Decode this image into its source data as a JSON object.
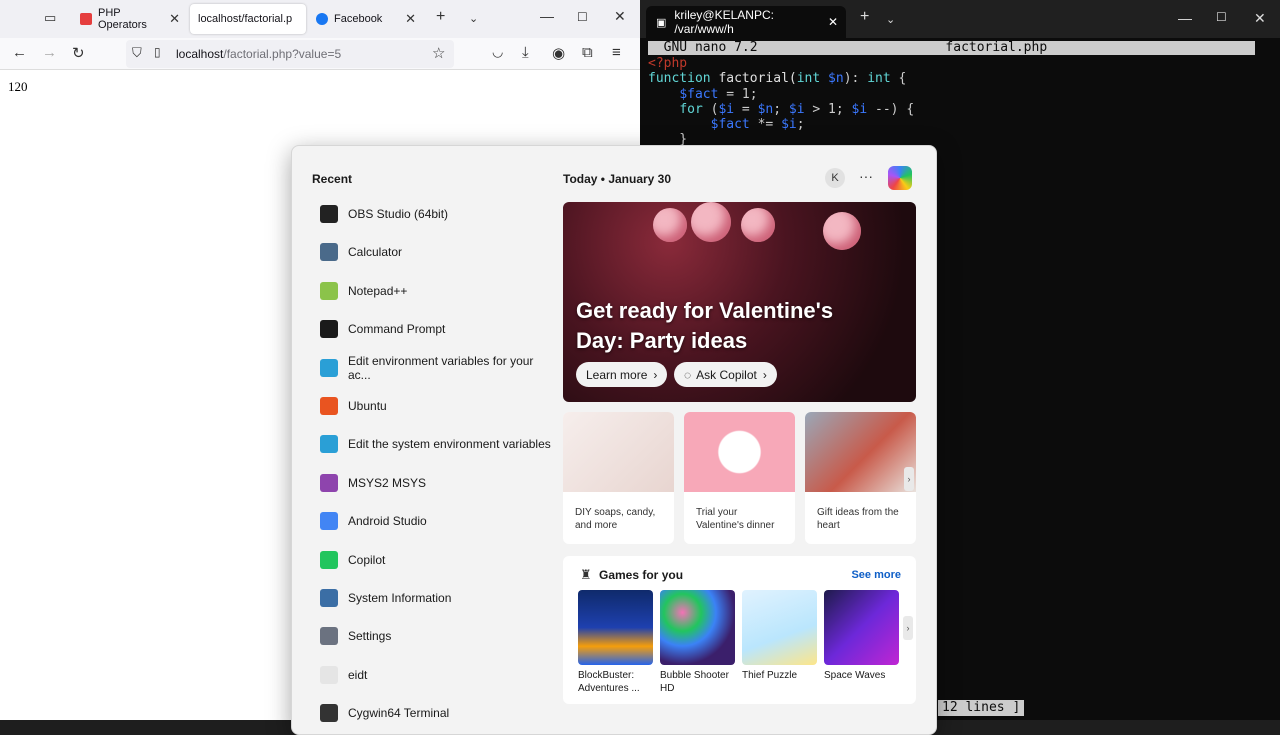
{
  "browser": {
    "tabs": [
      {
        "label": "PHP Operators",
        "favicon_color": "#e53e3e"
      },
      {
        "label": "localhost/factorial.p",
        "favicon_color": "#ffffff"
      },
      {
        "label": "Facebook",
        "favicon_color": "#1877f2"
      }
    ],
    "url_host": "localhost",
    "url_path": "/factorial.php?value=5",
    "page_output": "120"
  },
  "terminal": {
    "tab_title": "kriley@KELANPC: /var/www/h",
    "nano_header": "  GNU nano 7.2                        factorial.php",
    "status": "12 lines ]"
  },
  "start_menu": {
    "recent_title": "Recent",
    "recent_apps": [
      {
        "label": "OBS Studio (64bit)",
        "icon": "obs-icon",
        "color": "#222222"
      },
      {
        "label": "Calculator",
        "icon": "calculator-icon",
        "color": "#4a6a8a"
      },
      {
        "label": "Notepad++",
        "icon": "notepad-plus-plus-icon",
        "color": "#8bc34a"
      },
      {
        "label": "Command Prompt",
        "icon": "command-prompt-icon",
        "color": "#1a1a1a"
      },
      {
        "label": "Edit environment variables for your ac...",
        "icon": "monitor-icon",
        "color": "#2a9fd6"
      },
      {
        "label": "Ubuntu",
        "icon": "ubuntu-icon",
        "color": "#e95420"
      },
      {
        "label": "Edit the system environment variables",
        "icon": "monitor-icon",
        "color": "#2a9fd6"
      },
      {
        "label": "MSYS2 MSYS",
        "icon": "msys2-icon",
        "color": "#8e44ad"
      },
      {
        "label": "Android Studio",
        "icon": "android-studio-icon",
        "color": "#4285f4"
      },
      {
        "label": "Copilot",
        "icon": "copilot-icon",
        "color": "#22c55e"
      },
      {
        "label": "System Information",
        "icon": "system-information-icon",
        "color": "#3b6ea5"
      },
      {
        "label": "Settings",
        "icon": "gear-icon",
        "color": "#6b7280"
      },
      {
        "label": "eidt",
        "icon": "search-icon",
        "color": "#e5e5e5"
      },
      {
        "label": "Cygwin64 Terminal",
        "icon": "cygwin-icon",
        "color": "#333333"
      }
    ],
    "today_label": "Today  •  January 30",
    "avatar_letter": "K",
    "more_label": "···",
    "hero": {
      "title": "Get ready for Valentine's Day: Party ideas",
      "learn_more": "Learn more",
      "ask_copilot": "Ask Copilot"
    },
    "cards": [
      {
        "caption": "DIY soaps, candy, and more",
        "color": "#f3e7e4"
      },
      {
        "caption": "Trial your Valentine's dinner",
        "color": "#f7a8b8"
      },
      {
        "caption": "Gift ideas from the heart",
        "color": "#c85a4a"
      }
    ],
    "games": {
      "title": "Games for you",
      "see_more": "See more",
      "items": [
        {
          "name": "BlockBuster: Adventures ...",
          "color": "#1e3a8a"
        },
        {
          "name": "Bubble Shooter HD",
          "color": "#3b1f6b"
        },
        {
          "name": "Thief Puzzle",
          "color": "#e0f2fe"
        },
        {
          "name": "Space Waves",
          "color": "#6d28d9"
        }
      ]
    }
  }
}
